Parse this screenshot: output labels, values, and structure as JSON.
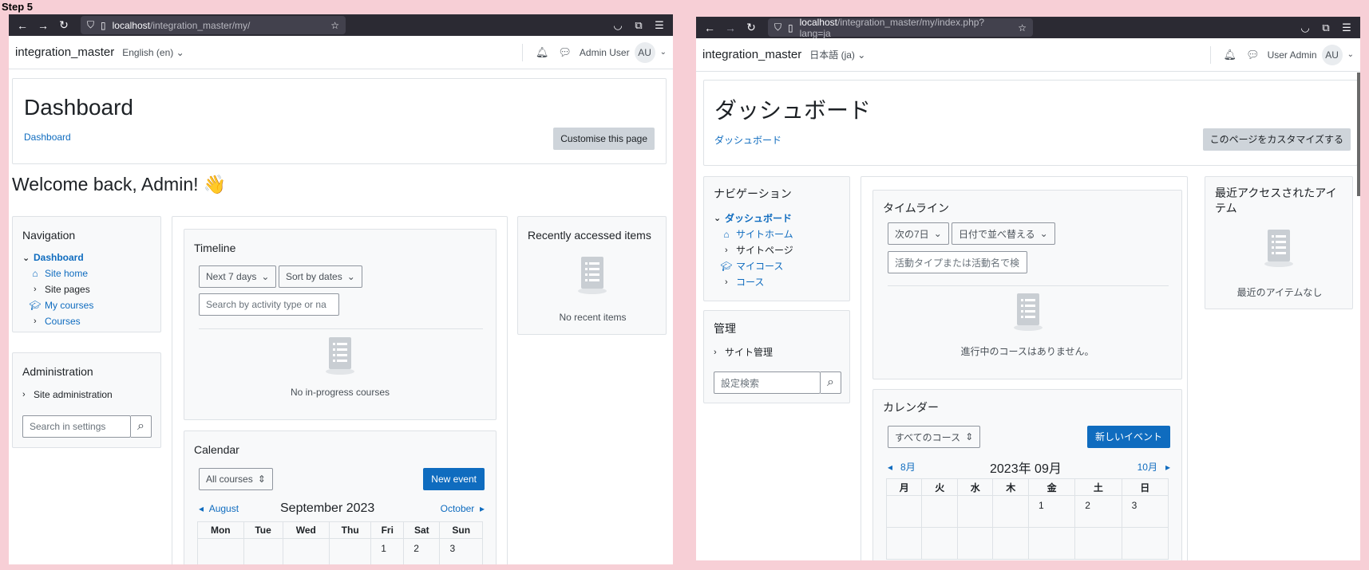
{
  "step_label": "Step 5",
  "left": {
    "url_host": "localhost",
    "url_path": "/integration_master/my/",
    "site_name": "integration_master",
    "language": "English (en)",
    "user_name": "Admin User",
    "avatar_initials": "AU",
    "page_title": "Dashboard",
    "breadcrumb": "Dashboard",
    "customise_label": "Customise this page",
    "welcome": "Welcome back, Admin! 👋",
    "navigation": {
      "title": "Navigation",
      "dashboard": "Dashboard",
      "site_home": "Site home",
      "site_pages": "Site pages",
      "my_courses": "My courses",
      "courses": "Courses"
    },
    "administration": {
      "title": "Administration",
      "site_admin": "Site administration",
      "search_placeholder": "Search in settings"
    },
    "timeline": {
      "title": "Timeline",
      "filter": "Next 7 days",
      "sort": "Sort by dates",
      "search_placeholder": "Search by activity type or na",
      "empty": "No in-progress courses"
    },
    "calendar": {
      "title": "Calendar",
      "course_filter": "All courses",
      "new_event": "New event",
      "prev": "August",
      "month": "September 2023",
      "next": "October",
      "days": [
        "Mon",
        "Tue",
        "Wed",
        "Thu",
        "Fri",
        "Sat",
        "Sun"
      ],
      "first_row": [
        "",
        "",
        "",
        "",
        "1",
        "2",
        "3"
      ]
    },
    "recent": {
      "title": "Recently accessed items",
      "empty": "No recent items"
    }
  },
  "right": {
    "url_host": "localhost",
    "url_path": "/integration_master/my/index.php?lang=ja",
    "site_name": "integration_master",
    "language": "日本語 (ja)",
    "user_name": "User Admin",
    "avatar_initials": "AU",
    "page_title": "ダッシュボード",
    "breadcrumb": "ダッシュボード",
    "customise_label": "このページをカスタマイズする",
    "navigation": {
      "title": "ナビゲーション",
      "dashboard": "ダッシュボード",
      "site_home": "サイトホーム",
      "site_pages": "サイトページ",
      "my_courses": "マイコース",
      "courses": "コース"
    },
    "administration": {
      "title": "管理",
      "site_admin": "サイト管理",
      "search_placeholder": "設定検索"
    },
    "timeline": {
      "title": "タイムライン",
      "filter": "次の7日",
      "sort": "日付で並べ替える",
      "search_placeholder": "活動タイプまたは活動名で検",
      "empty": "進行中のコースはありません。"
    },
    "calendar": {
      "title": "カレンダー",
      "course_filter": "すべてのコース",
      "new_event": "新しいイベント",
      "prev": "8月",
      "month": "2023年 09月",
      "next": "10月",
      "days": [
        "月",
        "火",
        "水",
        "木",
        "金",
        "土",
        "日"
      ],
      "first_row": [
        "",
        "",
        "",
        "",
        "1",
        "2",
        "3"
      ]
    },
    "recent": {
      "title": "最近アクセスされたアイテム",
      "empty": "最近のアイテムなし"
    }
  }
}
